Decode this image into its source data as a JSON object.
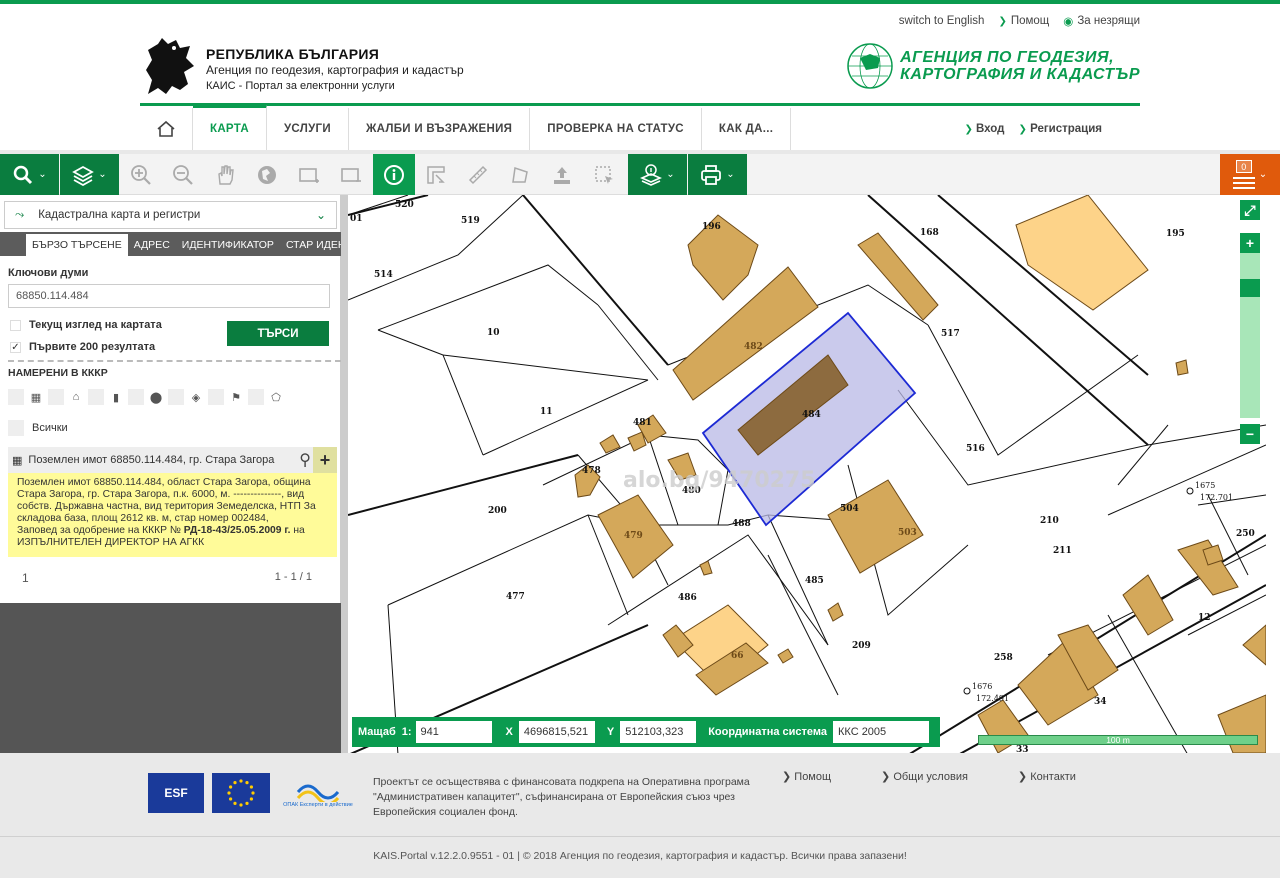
{
  "top_links": {
    "english": "switch to English",
    "help": "Помощ",
    "impaired": "За незрящи"
  },
  "header": {
    "line1": "РЕПУБЛИКА БЪЛГАРИЯ",
    "line2": "Агенция по геодезия, картография и кадастър",
    "line3": "КАИС - Портал за електронни услуги",
    "agency_line1": "АГЕНЦИЯ ПО ГЕОДЕЗИЯ,",
    "agency_line2": "КАРТОГРАФИЯ И КАДАСТЪР"
  },
  "nav": {
    "items": [
      {
        "label": "КАРТА"
      },
      {
        "label": "УСЛУГИ"
      },
      {
        "label": "ЖАЛБИ И ВЪЗРАЖЕНИЯ"
      },
      {
        "label": "ПРОВЕРКА НА СТАТУС"
      },
      {
        "label": "КАК ДА..."
      }
    ],
    "login": "Вход",
    "register": "Регистрация"
  },
  "toolbar": {
    "cart_count": "0"
  },
  "left_panel": {
    "layer_select": "Кадастрална карта и регистри",
    "tabs": [
      "БЪРЗО ТЪРСЕНЕ",
      "АДРЕС",
      "ИДЕНТИФИКАТОР",
      "СТАР ИДЕН"
    ],
    "keywords_label": "Ключови думи",
    "keywords_value": "68850.114.484",
    "current_view_label": "Текущ изглед на картата",
    "first200_label": "Първите 200 резултата",
    "search_button": "ТЪРСИ",
    "found_label": "НАМЕРЕНИ В КККР",
    "all_label": "Всички",
    "result_title": "Поземлен имот 68850.114.484, гр. Стара Загора",
    "result_text_1": "Поземлен имот 68850.114.484, област Стара Загора, община Стара Загора, гр. Стара Загора, п.к. 6000, м. --------------, вид собств. Държавна частна, вид територия Земеделска, НТП За складова база, площ 2612 кв. м, стар номер 002484,",
    "result_text_2": "Заповед за одобрение на КККР № ",
    "result_text_bold": "РД-18-43/25.05.2009 г.",
    "result_text_3": " на ИЗПЪЛНИТЕЛЕН ДИРЕКТОР НА АГКК",
    "page_current": "1",
    "page_range": "1 - 1 / 1"
  },
  "map": {
    "watermark": "alo.bg/9470275",
    "labels": [
      {
        "t": "520"
      },
      {
        "t": "519"
      },
      {
        "t": "514"
      },
      {
        "t": "10"
      },
      {
        "t": "11"
      },
      {
        "t": "196"
      },
      {
        "t": "168"
      },
      {
        "t": "195"
      },
      {
        "t": "517"
      },
      {
        "t": "482"
      },
      {
        "t": "484"
      },
      {
        "t": "516"
      },
      {
        "t": "481"
      },
      {
        "t": "480"
      },
      {
        "t": "478"
      },
      {
        "t": "479"
      },
      {
        "t": "488"
      },
      {
        "t": "200"
      },
      {
        "t": "504"
      },
      {
        "t": "503"
      },
      {
        "t": "210"
      },
      {
        "t": "211"
      },
      {
        "t": "250"
      },
      {
        "t": "477"
      },
      {
        "t": "486"
      },
      {
        "t": "485"
      },
      {
        "t": "209"
      },
      {
        "t": "12"
      },
      {
        "t": "258"
      },
      {
        "t": "66"
      },
      {
        "t": "34"
      },
      {
        "t": "33"
      },
      {
        "t": "1675"
      },
      {
        "t": "172.701"
      },
      {
        "t": "1676"
      },
      {
        "t": "172.491"
      },
      {
        "t": "01"
      }
    ]
  },
  "status_bar": {
    "scale_label": "Мащаб",
    "scale_prefix": "1:",
    "scale_value": "941",
    "x_label": "X",
    "x_value": "4696815,521",
    "y_label": "Y",
    "y_value": "512103,323",
    "crs_label": "Координатна система",
    "crs_value": "ККС 2005",
    "scalebar": "100 m"
  },
  "footer": {
    "text": "Проектът се осъществява с финансовата подкрепа на Оперативна програма \"Административен капацитет\", съфинансирана от Европейския съюз чрез Европейския социален фонд.",
    "links": [
      "Помощ",
      "Общи условия",
      "Контакти"
    ],
    "copyright": "KAIS.Portal v.12.2.0.9551 - 01  |  © 2018 Агенция по геодезия, картография и кадастър. Всички права запазени!",
    "eso_label": "ESF",
    "opak_label": "ОПАК Експерти в действие"
  },
  "colors": {
    "brand_green": "#0a9b4f",
    "dark_green": "#0a7d3f",
    "orange": "#e05a0c",
    "building": "#d4a85a",
    "highlight": "#b8b8e6"
  }
}
